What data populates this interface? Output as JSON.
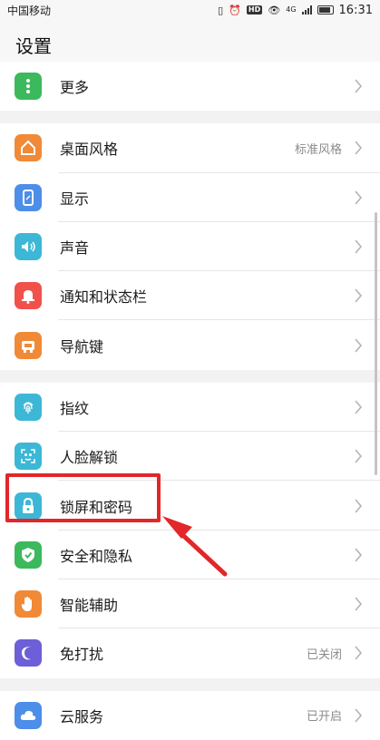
{
  "status_bar": {
    "carrier": "中国移动",
    "network": "4G",
    "time": "16:31",
    "icons": [
      "vibrate-icon",
      "alarm-icon",
      "hd-icon",
      "eye-icon",
      "signal-icon",
      "battery-icon"
    ]
  },
  "header": {
    "title": "设置"
  },
  "groups": [
    {
      "items": [
        {
          "label": "更多",
          "icon": "more-icon",
          "color": "#3cb95c"
        }
      ]
    },
    {
      "items": [
        {
          "label": "桌面风格",
          "value": "标准风格",
          "icon": "home-icon",
          "color": "#f08a36"
        },
        {
          "label": "显示",
          "icon": "display-icon",
          "color": "#4c8ee8"
        },
        {
          "label": "声音",
          "icon": "sound-icon",
          "color": "#3db7d6"
        },
        {
          "label": "通知和状态栏",
          "icon": "bell-icon",
          "color": "#f0524b"
        },
        {
          "label": "导航键",
          "icon": "navigation-icon",
          "color": "#f08a36"
        }
      ]
    },
    {
      "items": [
        {
          "label": "指纹",
          "icon": "fingerprint-icon",
          "color": "#3db7d6"
        },
        {
          "label": "人脸解锁",
          "icon": "face-icon",
          "color": "#3db7d6"
        },
        {
          "label": "锁屏和密码",
          "icon": "lock-icon",
          "color": "#3db7d6"
        },
        {
          "label": "安全和隐私",
          "icon": "shield-icon",
          "color": "#3cb95c"
        },
        {
          "label": "智能辅助",
          "icon": "hand-icon",
          "color": "#f08a36"
        },
        {
          "label": "免打扰",
          "value": "已关闭",
          "icon": "moon-icon",
          "color": "#6d5fd8"
        }
      ]
    },
    {
      "items": [
        {
          "label": "云服务",
          "value": "已开启",
          "icon": "cloud-icon",
          "color": "#4c8ee8"
        }
      ]
    }
  ],
  "annotation": {
    "highlight_color": "#e2262a"
  }
}
